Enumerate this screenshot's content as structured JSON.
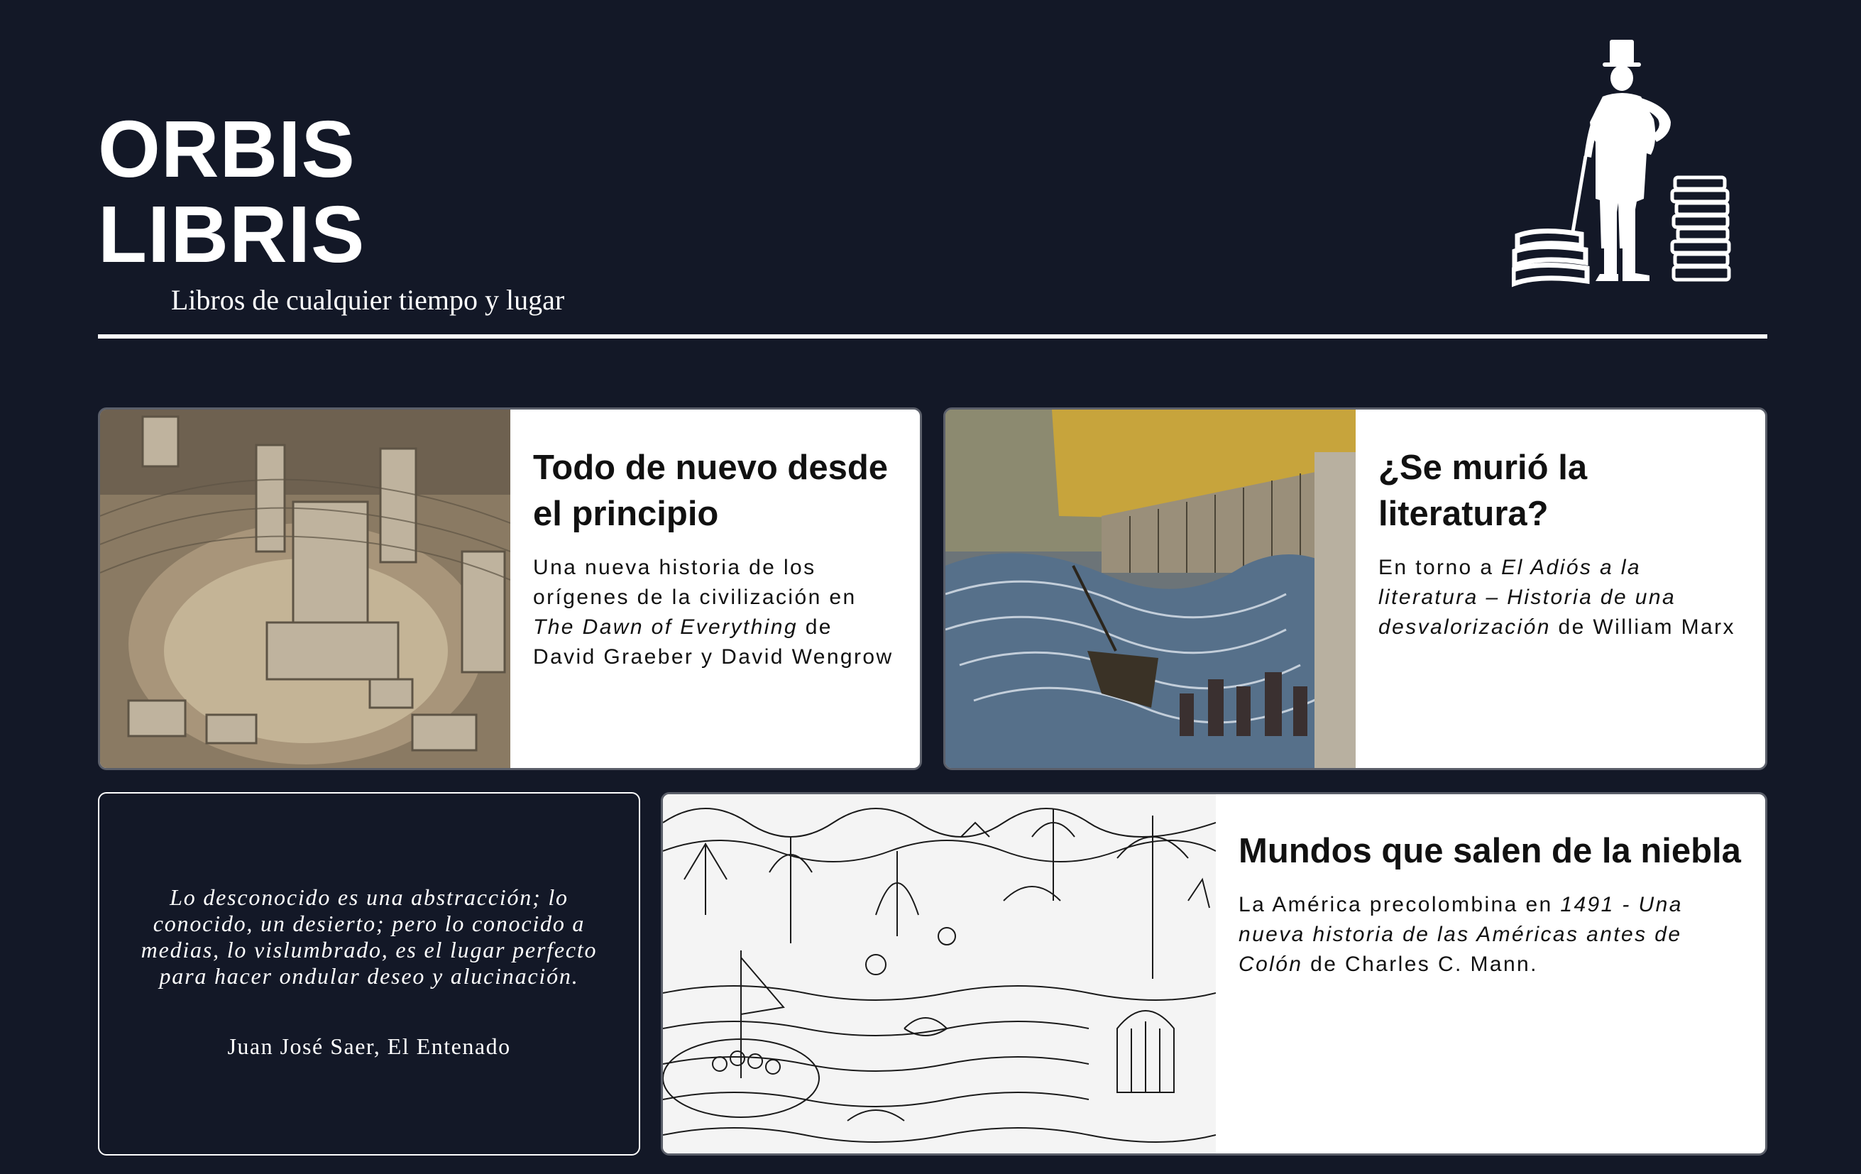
{
  "site": {
    "title": "ORBIS LIBRIS",
    "subtitle": "Libros de cualquier tiempo y lugar",
    "logo_icon": "gentleman-with-books-icon"
  },
  "colors": {
    "background": "#131827",
    "card_background": "#ffffff",
    "card_border": "#5b5f6a",
    "text_light": "#ffffff",
    "text_dark": "#111111"
  },
  "articles": [
    {
      "title": "Todo de nuevo desde el principio",
      "image_icon": "stone-ruins-photo",
      "desc_parts": [
        {
          "text": "Una nueva historia de los orígenes de la civilización en ",
          "italic": false
        },
        {
          "text": "The Dawn of Everything",
          "italic": true
        },
        {
          "text": " de David Graeber y David Wengrow",
          "italic": false
        }
      ]
    },
    {
      "title": "¿Se murió la literatura?",
      "image_icon": "earthquake-tsunami-engraving",
      "desc_parts": [
        {
          "text": "En torno a ",
          "italic": false
        },
        {
          "text": "El Adiós a la literatura – Historia de una desvalorización",
          "italic": true
        },
        {
          "text": " de William Marx",
          "italic": false
        }
      ]
    },
    {
      "title": "Mundos que salen de la niebla",
      "image_icon": "jungle-boat-ink-drawing",
      "desc_parts": [
        {
          "text": "La América precolombina en ",
          "italic": false
        },
        {
          "text": "1491 - Una nueva historia de las Américas antes de Colón",
          "italic": true
        },
        {
          "text": " de Charles C. Mann.",
          "italic": false
        }
      ]
    }
  ],
  "quote": {
    "text": "Lo desconocido es una abstracción; lo conocido, un desierto; pero lo conocido a medias, lo vislumbrado, es el lugar perfecto para hacer ondular deseo y alucinación.",
    "author": "Juan José Saer, El Entenado"
  }
}
